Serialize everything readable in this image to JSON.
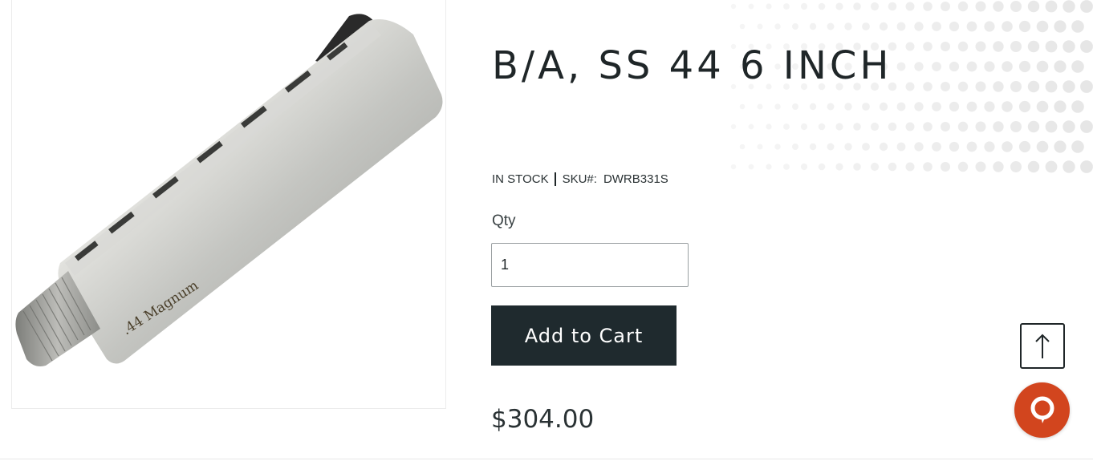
{
  "product": {
    "title": "B/A, SS 44 6 INCH",
    "image_alt": "Stainless .44 Magnum revolver barrel",
    "engraving": ".44 Magnum",
    "stock_status": "IN STOCK",
    "sku_label": "SKU#:",
    "sku_value": "DWRB331S",
    "price": "$304.00"
  },
  "purchase": {
    "qty_label": "Qty",
    "qty_value": "1",
    "add_to_cart_label": "Add to Cart"
  },
  "icons": {
    "scroll_top": "arrow-up-icon",
    "chat": "chat-bubble-icon"
  },
  "colors": {
    "button_bg": "#1f2a2e",
    "chat_bg": "#d2451e",
    "text": "#1f2628"
  }
}
